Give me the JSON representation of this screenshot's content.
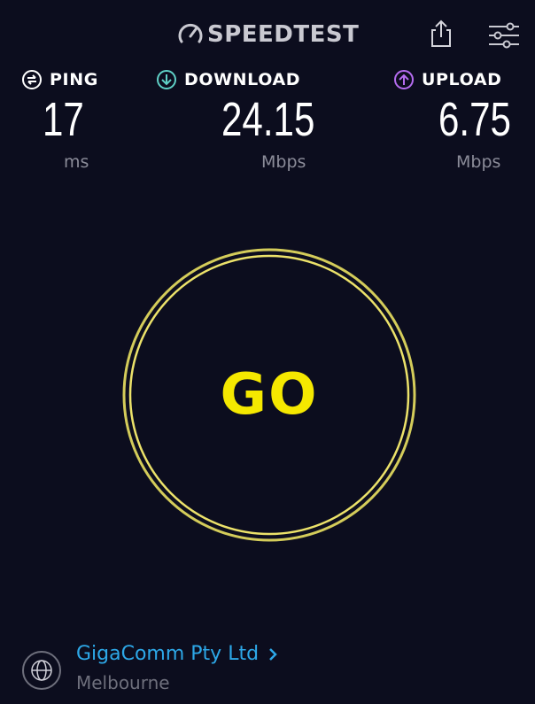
{
  "header": {
    "logo_text": "SPEEDTEST",
    "logo_icon": "speedometer-icon",
    "share_icon": "share-icon",
    "settings_icon": "sliders-icon"
  },
  "metrics": {
    "ping": {
      "label": "PING",
      "value": "17",
      "unit": "ms",
      "icon": "ping-icon",
      "color": "#ffffff"
    },
    "download": {
      "label": "DOWNLOAD",
      "value": "24.15",
      "unit": "Mbps",
      "icon": "download-arrow-icon",
      "color": "#5fd0c6"
    },
    "upload": {
      "label": "UPLOAD",
      "value": "6.75",
      "unit": "Mbps",
      "icon": "upload-arrow-icon",
      "color": "#b56cf0"
    }
  },
  "go_button": {
    "label": "GO",
    "color": "#f5e800"
  },
  "server": {
    "provider": "GigaComm Pty Ltd",
    "location": "Melbourne",
    "icon": "globe-icon",
    "chevron_icon": "chevron-right-icon",
    "link_color": "#2da8e8"
  }
}
